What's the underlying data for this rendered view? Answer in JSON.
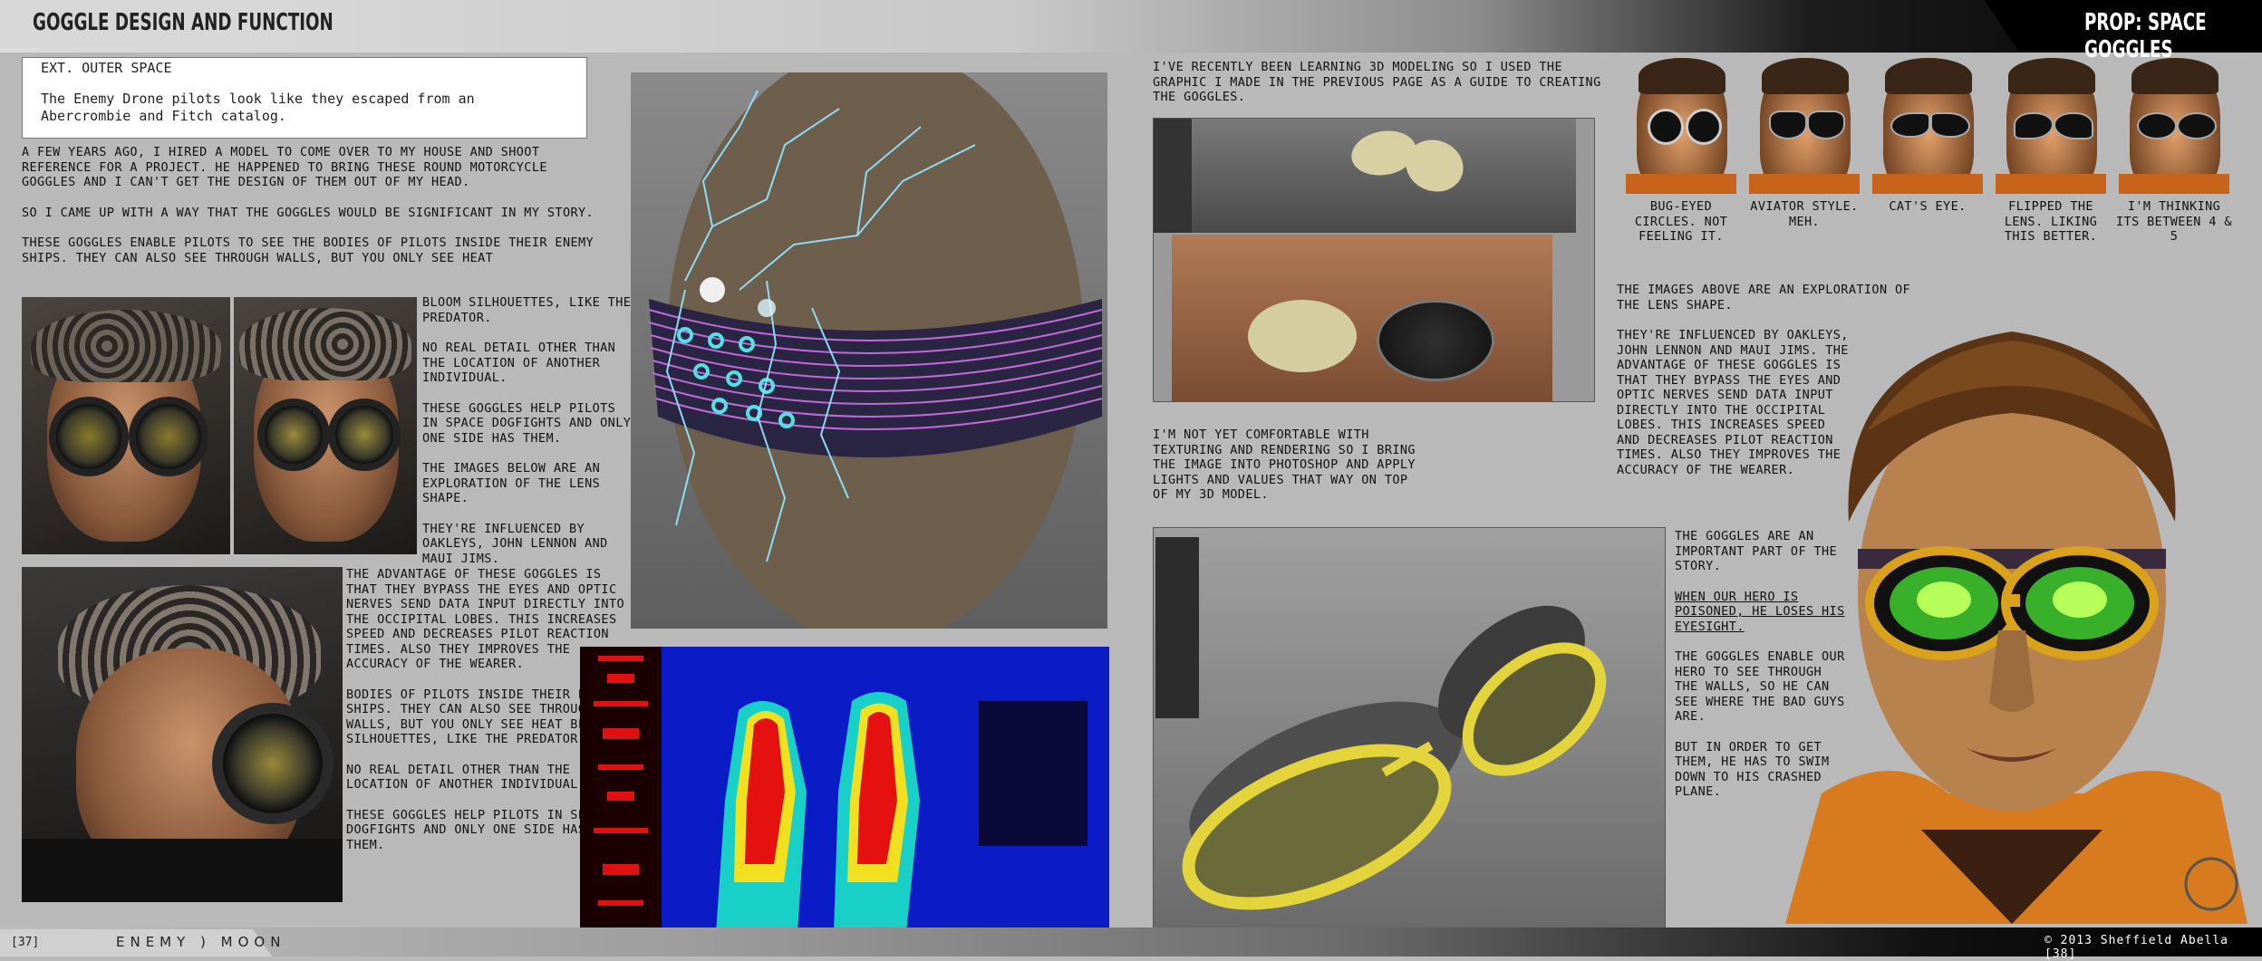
{
  "header": {
    "title": "GOGGLE DESIGN AND FUNCTION",
    "prop": "PROP: SPACE GOGGLES"
  },
  "script": {
    "slug": "EXT. OUTER SPACE",
    "line": "The Enemy Drone pilots look like they escaped from an Abercrombie and Fitch catalog."
  },
  "col1": {
    "p1": "A few years ago, I hired a model to come over to my house and shoot reference for a project.  He happened to bring these round motorcycle goggles and I can't get the design of them out of my head.",
    "p2": "So I came up with a way that the goggles would be significant in my story.",
    "p3": "These goggles enable pilots to see the bodies of pilots inside their enemy ships.  They can also see through walls, but you only see heat",
    "side1": "bloom silhouettes, like the predator.",
    "side2": "No real detail other than the location of another individual.",
    "side3": "These goggles help pilots in space dogfights and only one side has them.",
    "side4": "The images below are an exploration of the lens shape.",
    "side5": "they're influenced by oakleys, John Lennon and Maui Jims.",
    "lower1": "The advantage of these goggles is that they bypass the eyes and optic nerves send data input directly into the occipital lobes. This increases speed and decreases pilot reaction times.  Also they improves the accuracy of the wearer.",
    "lower2": "bodies of pilots inside their enemy ships.  They can also see through walls, but you only see heat bloom silhouettes, like the predator.",
    "lower3": "No real detail other than the location of another individual.",
    "lower4": "These goggles help pilots in space dogfights and only one side has them."
  },
  "col3": {
    "p1": "I've recently been learning 3D Modeling so I used the graphic I made in the previous page as a guide to creating the goggles.",
    "p2": "I'm not yet comfortable with texturing and rendering so I bring the image into photoshop and apply lights and values that way on top of my 3D model."
  },
  "variants": [
    {
      "label": "Bug-Eyed Circles. Not feeling it.",
      "lens": "circle"
    },
    {
      "label": "Aviator style.  Meh.",
      "lens": "aviator"
    },
    {
      "label": "Cat's Eye.",
      "lens": "cat"
    },
    {
      "label": "Flipped the lens. Liking this better.",
      "lens": "flipped"
    },
    {
      "label": "I'm thinking its between 4 & 5",
      "lens": "oval"
    }
  ],
  "col4": {
    "p1": "The images above are an exploration of the lens shape.",
    "p2": "they're influenced by oakleys, John Lennon and Maui Jims. The advantage of these goggles is that they bypass the eyes and optic nerves send data input directly into the occipital lobes. This increases speed and decreases pilot reaction times.  Also they improves the accuracy of the wearer.",
    "s1": "The goggles are an important part of the story.",
    "s2": "When our hero is poisoned, he loses his eyesight.",
    "s3": "The goggles enable our hero to see through the walls, so he can see where the bad guys are.",
    "s4": "But in order to get them, he has to swim down to his crashed plane."
  },
  "footer": {
    "page_left": "[37]",
    "brand": "ENEMY ) MOON",
    "copyright": "© 2013 Sheffield Abella  [38]"
  },
  "colors": {
    "background": "#b9b9b9",
    "goggle_purple": "#c06ad8",
    "goggle_yellow": "#e2d43a",
    "lens_green": "#6de22a",
    "electric_blue": "#7fd8ff"
  }
}
